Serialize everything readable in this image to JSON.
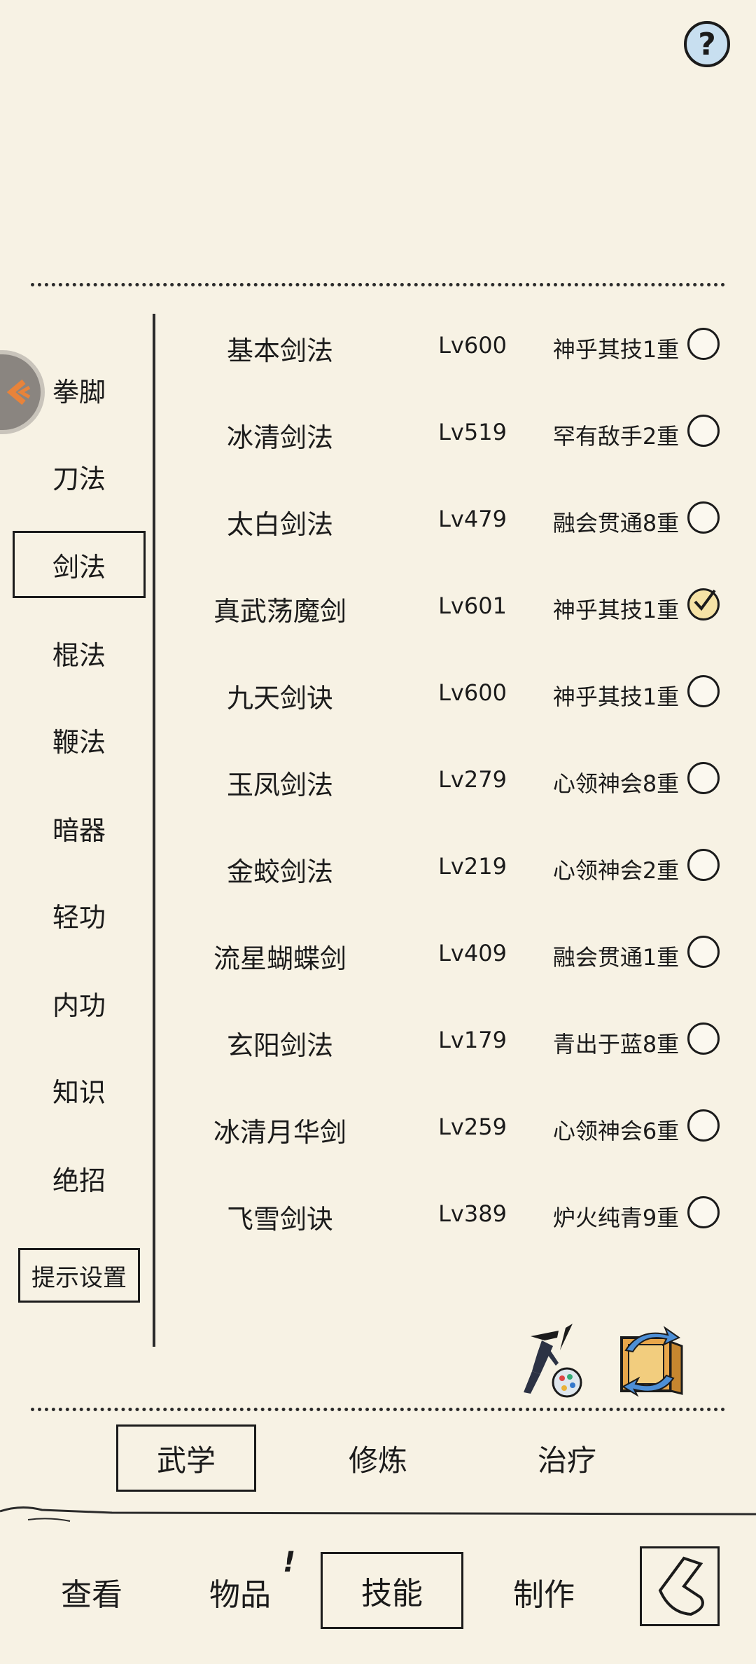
{
  "help": {
    "label": "?"
  },
  "categories": [
    {
      "label": "拳脚",
      "active": false
    },
    {
      "label": "刀法",
      "active": false
    },
    {
      "label": "剑法",
      "active": true
    },
    {
      "label": "棍法",
      "active": false
    },
    {
      "label": "鞭法",
      "active": false
    },
    {
      "label": "暗器",
      "active": false
    },
    {
      "label": "轻功",
      "active": false
    },
    {
      "label": "内功",
      "active": false
    },
    {
      "label": "知识",
      "active": false
    },
    {
      "label": "绝招",
      "active": false
    }
  ],
  "hint_settings": {
    "label": "提示设置"
  },
  "skills": [
    {
      "name": "基本剑法",
      "level": "Lv600",
      "rank": "神乎其技1重",
      "checked": false
    },
    {
      "name": "冰清剑法",
      "level": "Lv519",
      "rank": "罕有敌手2重",
      "checked": false
    },
    {
      "name": "太白剑法",
      "level": "Lv479",
      "rank": "融会贯通8重",
      "checked": false
    },
    {
      "name": "真武荡魔剑",
      "level": "Lv601",
      "rank": "神乎其技1重",
      "checked": true
    },
    {
      "name": "九天剑诀",
      "level": "Lv600",
      "rank": "神乎其技1重",
      "checked": false
    },
    {
      "name": "玉凤剑法",
      "level": "Lv279",
      "rank": "心领神会8重",
      "checked": false
    },
    {
      "name": "金蛟剑法",
      "level": "Lv219",
      "rank": "心领神会2重",
      "checked": false
    },
    {
      "name": "流星蝴蝶剑",
      "level": "Lv409",
      "rank": "融会贯通1重",
      "checked": false
    },
    {
      "name": "玄阳剑法",
      "level": "Lv179",
      "rank": "青出于蓝8重",
      "checked": false
    },
    {
      "name": "冰清月华剑",
      "level": "Lv259",
      "rank": "心领神会6重",
      "checked": false
    },
    {
      "name": "飞雪剑诀",
      "level": "Lv389",
      "rank": "炉火纯青9重",
      "checked": false
    }
  ],
  "subtabs": [
    {
      "label": "武学",
      "active": true
    },
    {
      "label": "修炼",
      "active": false
    },
    {
      "label": "治疗",
      "active": false
    }
  ],
  "bottom_nav": [
    {
      "label": "查看",
      "active": false
    },
    {
      "label": "物品",
      "active": false,
      "badge": "!"
    },
    {
      "label": "技能",
      "active": true
    },
    {
      "label": "制作",
      "active": false
    }
  ],
  "colors": {
    "background": "#f7f2e4",
    "ink": "#1b1b1b",
    "help_bg": "#c8dff0",
    "checked_bg": "#f6e3a6"
  }
}
